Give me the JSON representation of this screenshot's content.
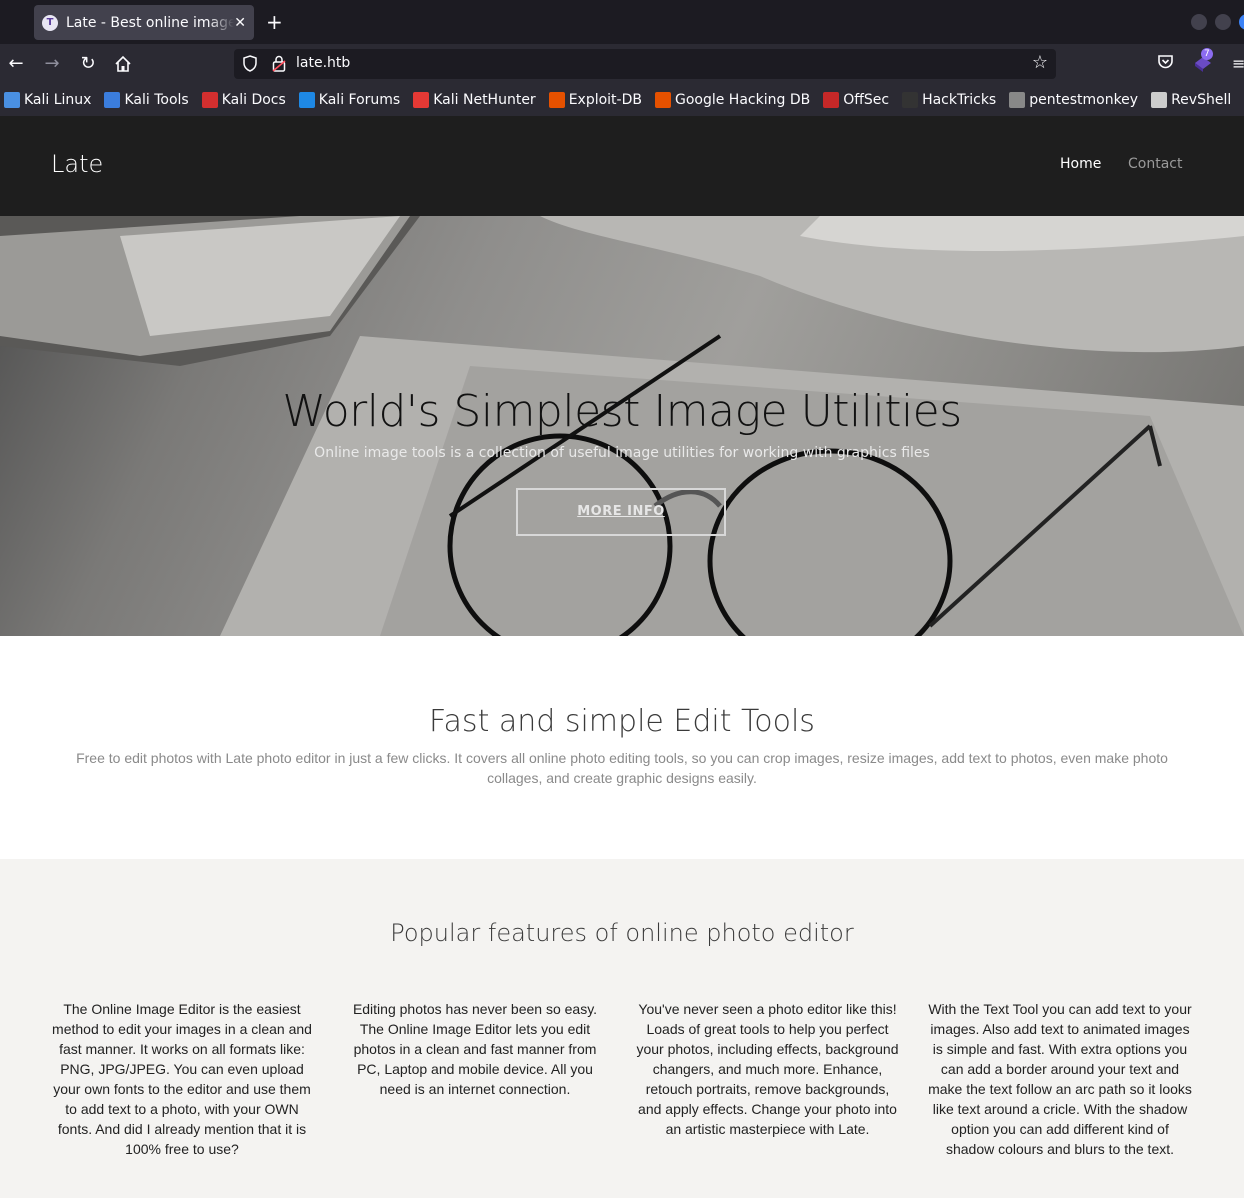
{
  "browser": {
    "tab_title": "Late - Best online image tools",
    "tab_favicon_letter": "T",
    "url": "late.htb",
    "extension_badge": "7",
    "bookmarks": [
      {
        "label": "Kali Linux",
        "color": "#4a90e2"
      },
      {
        "label": "Kali Tools",
        "color": "#3b7ddd"
      },
      {
        "label": "Kali Docs",
        "color": "#d32f2f"
      },
      {
        "label": "Kali Forums",
        "color": "#1e88e5"
      },
      {
        "label": "Kali NetHunter",
        "color": "#e53935"
      },
      {
        "label": "Exploit-DB",
        "color": "#e65100"
      },
      {
        "label": "Google Hacking DB",
        "color": "#e65100"
      },
      {
        "label": "OffSec",
        "color": "#c62828"
      },
      {
        "label": "HackTricks",
        "color": "#333333"
      },
      {
        "label": "pentestmonkey",
        "color": "#888888"
      },
      {
        "label": "RevShell",
        "color": "#cccccc"
      }
    ]
  },
  "site": {
    "brand": "Late",
    "nav": {
      "home": "Home",
      "contact": "Contact"
    },
    "hero": {
      "title": "World's Simplest Image Utilities",
      "subtitle": "Online image tools is a collection of useful image utilities for working with graphics files",
      "button": "MORE INFO"
    },
    "intro": {
      "heading": "Fast and simple Edit Tools",
      "text": "Free to edit photos with Late photo editor in just a few clicks. It covers all online photo editing tools, so you can crop images, resize images, add text to photos, even make photo collages, and create graphic designs easily."
    },
    "features": {
      "heading": "Popular features of online photo editor",
      "items": [
        "The Online Image Editor is the easiest method to edit your images in a clean and fast manner. It works on all formats like: PNG, JPG/JPEG. You can even upload your own fonts to the editor and use them to add text to a photo, with your OWN fonts. And did I already mention that it is 100% free to use?",
        "Editing photos has never been so easy. The Online Image Editor lets you edit photos in a clean and fast manner from PC, Laptop and mobile device. All you need is an internet connection.",
        "You've never seen a photo editor like this! Loads of great tools to help you perfect your photos, including effects, background changers, and much more. Enhance, retouch portraits, remove backgrounds, and apply effects. Change your photo into an artistic masterpiece with Late.",
        "With the Text Tool you can add text to your images. Also add text to animated images is simple and fast. With extra options you can add a border around your text and make the text follow an arc path so it looks like text around a cricle. With the shadow option you can add different kind of shadow colours and blurs to the text."
      ]
    }
  }
}
